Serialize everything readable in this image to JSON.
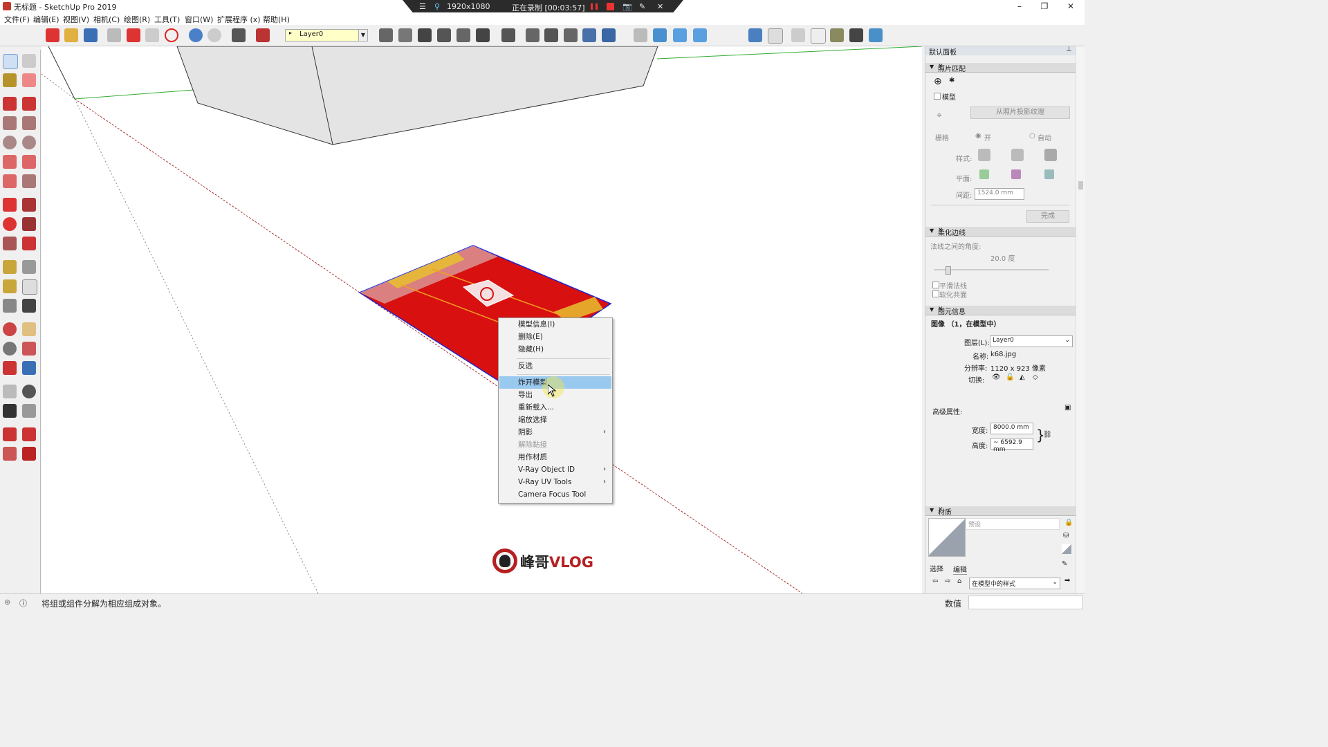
{
  "window": {
    "title": "无标题 - SketchUp Pro 2019",
    "controls": [
      "–",
      "❐",
      "✕"
    ]
  },
  "recorder": {
    "resolution": "1920x1080",
    "status": "正在录制 [00:03:57]"
  },
  "menubar": {
    "items": [
      "文件(F)",
      "编辑(E)",
      "视图(V)",
      "相机(C)",
      "绘图(R)",
      "工具(T)",
      "窗口(W)",
      "扩展程序 (x)",
      "帮助(H)"
    ]
  },
  "toolbar": {
    "layer_value": "Layer0"
  },
  "context_menu": {
    "items": [
      {
        "label": "模型信息(I)"
      },
      {
        "label": "删除(E)"
      },
      {
        "label": "隐藏(H)"
      },
      {
        "label": "反选"
      },
      {
        "label": "炸开模型"
      },
      {
        "label": "导出"
      },
      {
        "label": "重新载入..."
      },
      {
        "label": "缩放选择"
      },
      {
        "label": "阴影"
      },
      {
        "label": "解除黏接"
      },
      {
        "label": "用作材质"
      },
      {
        "label": "V-Ray Object ID"
      },
      {
        "label": "V-Ray UV Tools"
      },
      {
        "label": "Camera Focus Tool"
      }
    ],
    "submenu_glyph": "›"
  },
  "watermark": {
    "text_cn": "峰哥",
    "text_en": "VLOG"
  },
  "panel": {
    "tray_title": "默认面板",
    "photo_match": {
      "title": "照片匹配",
      "model_label": "模型",
      "project_button": "从照片投影纹理",
      "grid_label": "栅格",
      "on_label": "开",
      "auto_label": "自动",
      "style_label": "样式:",
      "plane_label": "平面:",
      "spacing_label": "间距:",
      "spacing_value": "1524.0 mm",
      "done_button": "完成"
    },
    "soften": {
      "title": "柔化边线",
      "angle_label": "法线之间的角度:",
      "angle_value": "20.0  度",
      "angle_fraction": 0.12,
      "smooth_label": "平滑法线",
      "coplanar_label": "软化共面"
    },
    "entity_info": {
      "title": "图元信息",
      "heading": "图像 （1，在模型中）",
      "layer_label": "图层(L):",
      "layer_value": "Layer0",
      "name_label": "名称:",
      "name_value": "k68.jpg",
      "resolution_label": "分辨率:",
      "resolution_value": "1120 x 923 像素",
      "toggle_label": "切换:",
      "advanced_label": "高级属性:",
      "width_label": "宽度:",
      "width_value": "8000.0 mm",
      "height_label": "高度:",
      "height_value": "~ 6592.9 mm"
    },
    "materials": {
      "title": "材质",
      "preset_placeholder": "预设",
      "tab_select": "选择",
      "tab_edit": "编辑",
      "collection_value": "在模型中的样式"
    }
  },
  "statusbar": {
    "hint": "将组或组件分解为相应组成对象。",
    "measurement_label": "数值"
  },
  "colors": {
    "accent_red": "#cc1a1a",
    "highlight": "#99c9ef",
    "layer_bg": "#ffffc8"
  }
}
